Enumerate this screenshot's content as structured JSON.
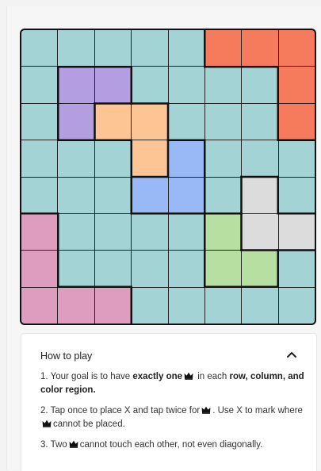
{
  "board": {
    "size": 8,
    "colors": {
      "teal": "#a3d3d4",
      "orange": "#f67b5c",
      "purple": "#b39ee2",
      "peach": "#fdc594",
      "blue": "#98b9f6",
      "gray": "#dcdcdc",
      "green": "#b7dfa1",
      "pink": "#de9dbe"
    },
    "grid": [
      [
        "teal",
        "teal",
        "teal",
        "teal",
        "teal",
        "orange",
        "orange",
        "orange"
      ],
      [
        "teal",
        "purple",
        "purple",
        "teal",
        "teal",
        "teal",
        "teal",
        "orange"
      ],
      [
        "teal",
        "purple",
        "peach",
        "peach",
        "teal",
        "teal",
        "teal",
        "orange"
      ],
      [
        "teal",
        "teal",
        "teal",
        "peach",
        "blue",
        "teal",
        "teal",
        "teal"
      ],
      [
        "teal",
        "teal",
        "teal",
        "blue",
        "blue",
        "teal",
        "gray",
        "teal"
      ],
      [
        "pink",
        "teal",
        "teal",
        "teal",
        "teal",
        "green",
        "gray",
        "gray"
      ],
      [
        "pink",
        "teal",
        "teal",
        "teal",
        "teal",
        "green",
        "green",
        "teal"
      ],
      [
        "pink",
        "pink",
        "pink",
        "teal",
        "teal",
        "teal",
        "teal",
        "teal"
      ]
    ]
  },
  "how_to_play": {
    "title": "How to play",
    "rule1": {
      "num": "1.",
      "t1": "Your goal is to have ",
      "b1": "exactly one",
      "t2": " in each ",
      "b2": "row, column, and color region."
    },
    "rule2": {
      "num": "2.",
      "t1": "Tap once to place X and tap twice for",
      "t2": ". Use X to mark where",
      "t3": "cannot be placed."
    },
    "rule3": {
      "num": "3.",
      "t1": "Two",
      "t2": "cannot touch each other, not even diagonally."
    }
  },
  "icons": {
    "collapse": "chevron-up-icon",
    "queen": "crown-icon"
  }
}
